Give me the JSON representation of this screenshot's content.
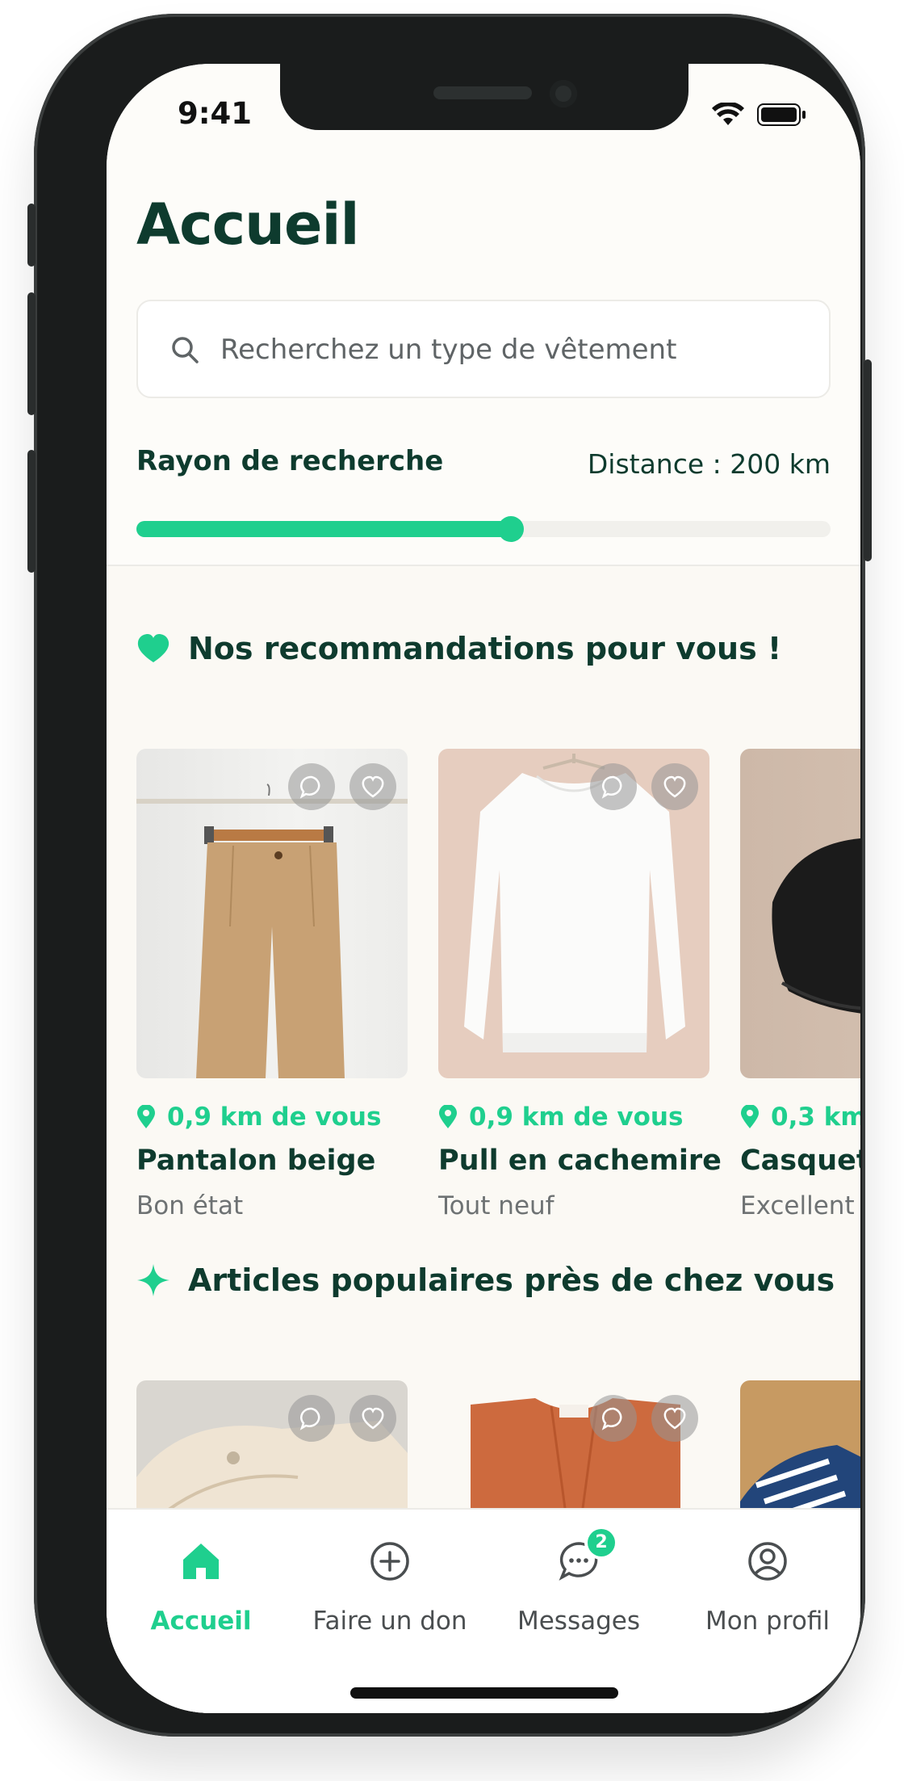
{
  "status": {
    "time": "9:41"
  },
  "header": {
    "title": "Accueil",
    "search_placeholder": "Recherchez un type de vêtement",
    "radius_label": "Rayon de recherche",
    "distance_label": "Distance : 200 km",
    "slider_value_fraction": 0.54
  },
  "recommendations": {
    "title": "Nos recommandations pour vous !",
    "items": [
      {
        "distance": "0,9 km de vous",
        "name": "Pantalon beige",
        "condition": "Bon état"
      },
      {
        "distance": "0,9 km de vous",
        "name": "Pull en cachemire",
        "condition": "Tout neuf"
      },
      {
        "distance": "0,3 km",
        "name": "Casquet",
        "condition": "Excellent"
      }
    ]
  },
  "popular": {
    "title": "Articles populaires près de chez vous"
  },
  "tabbar": {
    "tabs": [
      {
        "label": "Accueil",
        "icon": "home-icon",
        "active": true
      },
      {
        "label": "Faire un don",
        "icon": "plus-circle-icon"
      },
      {
        "label": "Messages",
        "icon": "chat-bubble-icon",
        "badge": "2"
      },
      {
        "label": "Mon profil",
        "icon": "user-circle-icon"
      }
    ]
  },
  "colors": {
    "accent": "#1fcf8e",
    "title": "#0e3b2e",
    "background": "#fbf9f4"
  }
}
